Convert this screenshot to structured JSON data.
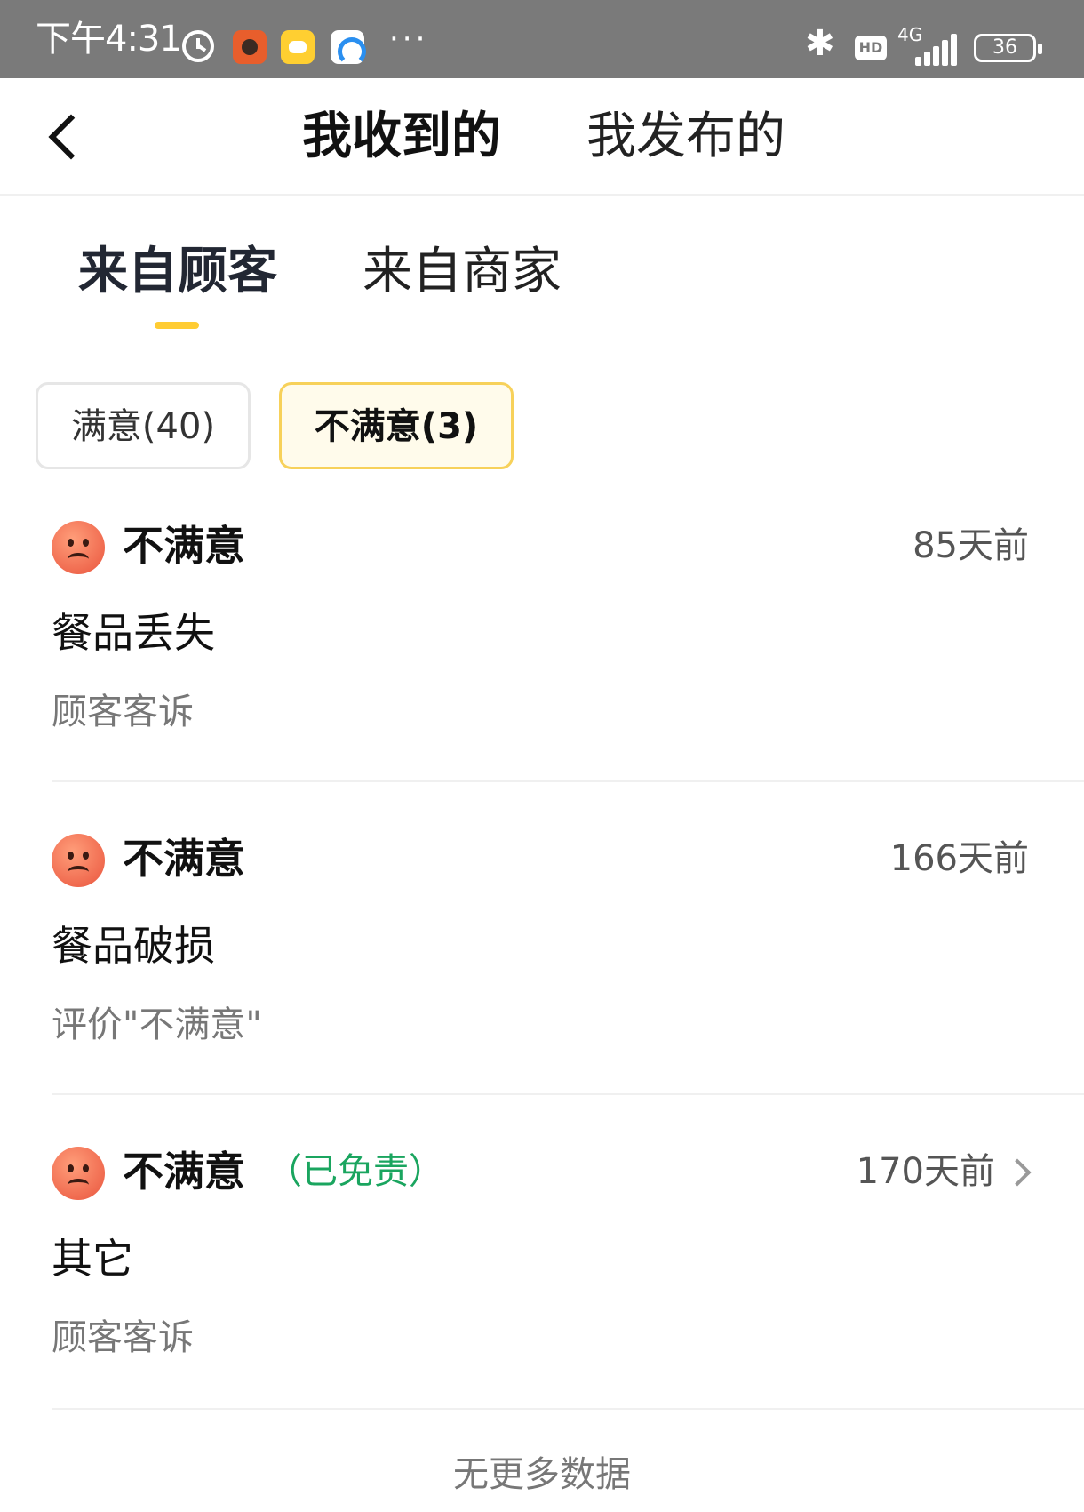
{
  "status_bar": {
    "time": "下午4:31",
    "more": "···",
    "network": "4G",
    "hd_badge": "HD",
    "battery": "36",
    "icons": [
      "alarm-icon",
      "app-icon",
      "app-icon",
      "app-icon",
      "bluetooth-icon",
      "signal-icon",
      "battery-icon"
    ]
  },
  "header": {
    "back_icon": "chevron-left-icon",
    "tabs": [
      {
        "label": "我收到的",
        "active": true
      },
      {
        "label": "我发布的",
        "active": false
      }
    ]
  },
  "sub_tabs": [
    {
      "label": "来自顾客",
      "active": true
    },
    {
      "label": "来自商家",
      "active": false
    }
  ],
  "filters": [
    {
      "label": "满意(40)",
      "active": false
    },
    {
      "label": "不满意(3)",
      "active": true
    }
  ],
  "reviews": [
    {
      "rating": "不满意",
      "time_ago": "85天前",
      "reason": "餐品丢失",
      "source": "顾客客诉",
      "icon": "sad-face-icon"
    },
    {
      "rating": "不满意",
      "time_ago": "166天前",
      "reason": "餐品破损",
      "source": "评价\"不满意\"",
      "icon": "sad-face-icon"
    },
    {
      "rating": "不满意",
      "exempt": "（已免责）",
      "time_ago": "170天前",
      "reason": "其它",
      "source": "顾客客诉",
      "icon": "sad-face-icon",
      "has_detail_chevron": true
    }
  ],
  "footer": {
    "no_more_data": "无更多数据"
  },
  "colors": {
    "accent_yellow": "#ffcc33",
    "chip_active_bg": "#fffbeb",
    "chip_active_border": "#f7d15a",
    "exempt_green": "#1aa55f",
    "status_bar_bg": "#7a7a7a"
  }
}
